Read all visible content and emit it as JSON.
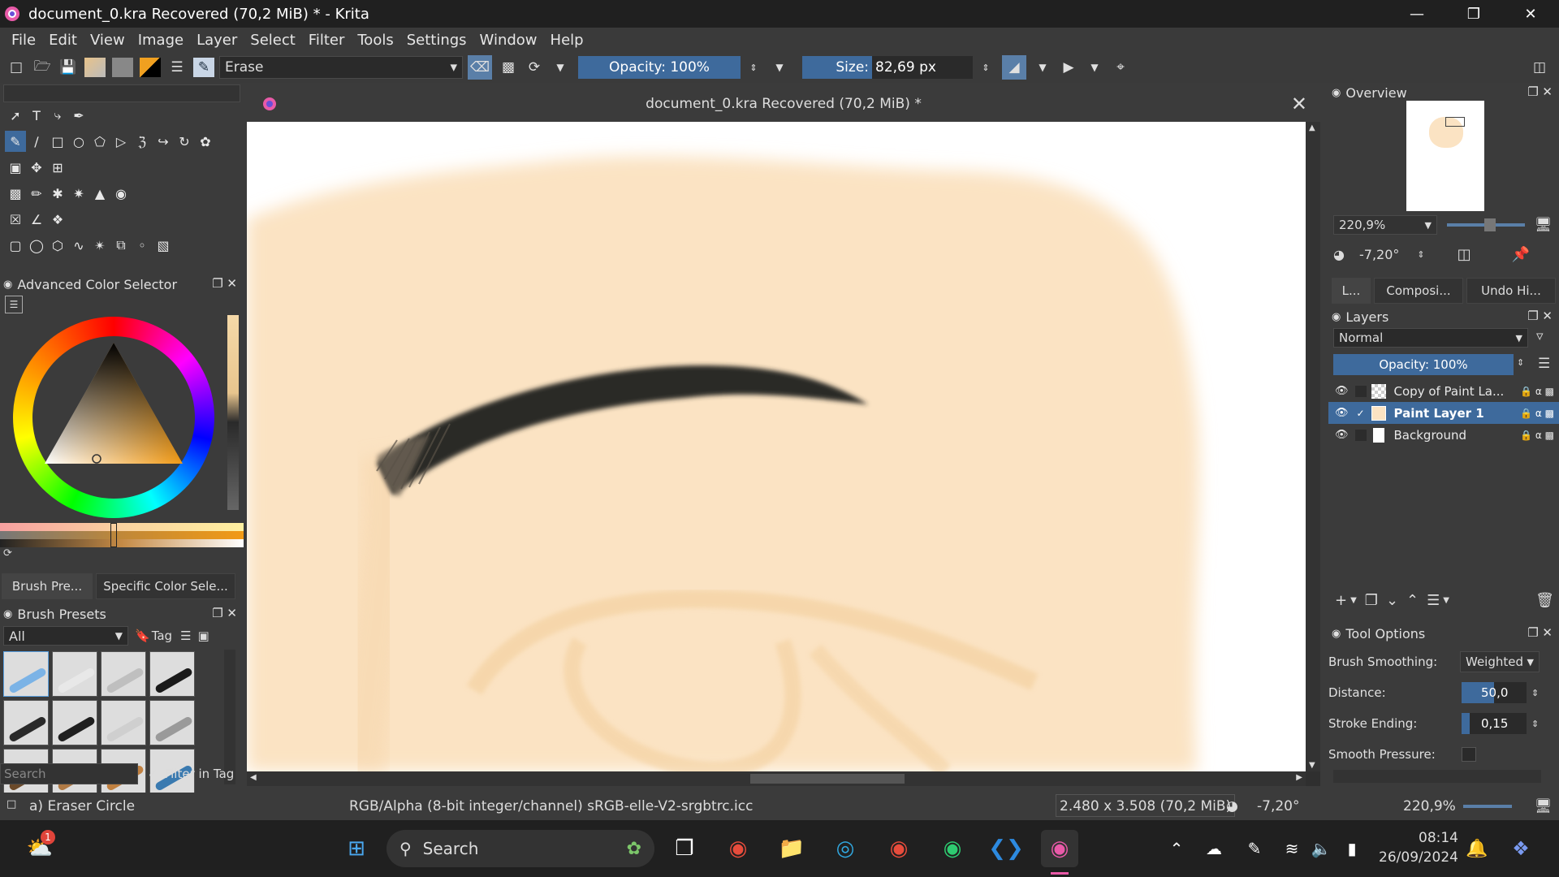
{
  "window": {
    "title": "document_0.kra Recovered (70,2 MiB) * - Krita"
  },
  "menu": [
    "File",
    "Edit",
    "View",
    "Image",
    "Layer",
    "Select",
    "Filter",
    "Tools",
    "Settings",
    "Window",
    "Help"
  ],
  "toolbar": {
    "blend_mode": "Erase",
    "opacity_label": "Opacity: 100%",
    "size_label": "Size:",
    "size_value": "82,69 px"
  },
  "document": {
    "tab_title": "document_0.kra Recovered (70,2 MiB) *"
  },
  "left_panels": {
    "color_selector_title": "Advanced Color Selector",
    "tabs": [
      "Brush Pre...",
      "Specific Color Sele..."
    ],
    "brush_presets_title": "Brush Presets",
    "filter_all": "All",
    "tag_label": "Tag",
    "search_placeholder": "Search",
    "filter_in_tag": "Filter in Tag",
    "brush_colors": [
      "#7bb3e6",
      "#e8e8e8",
      "#bfbfbf",
      "#1a1a1a",
      "#2a2a2a",
      "#1f1f1f",
      "#cfcfcf",
      "#9a9a9a",
      "#6b4a2a",
      "#b07a45",
      "#c08040",
      "#3a7ab0"
    ]
  },
  "overview": {
    "title": "Overview",
    "zoom": "220,9%",
    "rotation": "-7,20°"
  },
  "dock_tabs": [
    "L...",
    "Composi...",
    "Undo Hi..."
  ],
  "layers": {
    "title": "Layers",
    "blend": "Normal",
    "opacity": "Opacity:  100%",
    "items": [
      {
        "name": "Copy of Paint La...",
        "selected": false
      },
      {
        "name": "Paint Layer 1",
        "selected": true
      },
      {
        "name": "Background",
        "selected": false
      }
    ]
  },
  "tool_options": {
    "title": "Tool Options",
    "brush_smoothing_label": "Brush Smoothing:",
    "brush_smoothing_value": "Weighted",
    "distance_label": "Distance:",
    "distance_value": "50,0",
    "stroke_ending_label": "Stroke Ending:",
    "stroke_ending_value": "0,15",
    "smooth_pressure_label": "Smooth Pressure:"
  },
  "status": {
    "brush": "a) Eraser Circle",
    "color_space": "RGB/Alpha (8-bit integer/channel)  sRGB-elle-V2-srgbtrc.icc",
    "dims": "2.480 x 3.508 (70,2 MiB)",
    "rotation": "-7,20°",
    "zoom": "220,9%"
  },
  "taskbar": {
    "search": "Search",
    "time": "08:14",
    "date": "26/09/2024",
    "notif_count": "1"
  },
  "colors": {
    "skin": "#fbe3c3",
    "accent": "#3e6a9c"
  }
}
